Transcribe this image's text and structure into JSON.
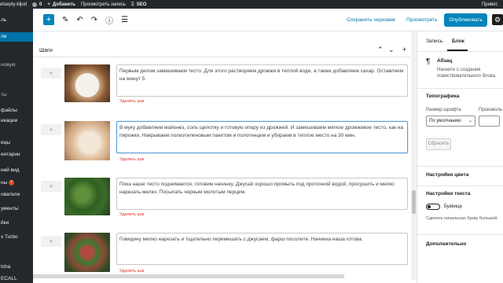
{
  "admin_bar": {
    "site": "etsepty-bljud",
    "comments": "0",
    "new": "Добавить",
    "view": "Просмотреть запись",
    "seo": "SEO",
    "greeting": "Привет, "
  },
  "side_menu": {
    "items": [
      "ль",
      "ли",
      "новую",
      "ты",
      "файлы",
      "икации",
      "ицы",
      "ентарии",
      "ний вид",
      "ны",
      "ователи",
      "ументы",
      "йки",
      "x Turbo",
      "tcha",
      "ECALL"
    ],
    "plugins_badge": "7"
  },
  "toolbar": {
    "save_draft": "Сохранить черновик",
    "preview": "Просмотреть",
    "publish": "Опубликовать"
  },
  "block": {
    "title": "Шаги",
    "steps": [
      {
        "text": "Первым делом замешиваем тесто. Для этого растворяем дрожжи в теплой воде, а также добавляем сахар. Оставляем на минут 5.",
        "delete": "Удалить шаг"
      },
      {
        "text": "В муку добавляем майонез, соль щепотку и готовую опару из дрожжей. И замешиваем мягкое дрожжевое тесто, как на пирожки. Накрываем полиэтиленовым пакетом и полотенцем и убираем в теплое место на 30 мин.",
        "delete": "Удалить шаг"
      },
      {
        "text": "Пока наше тесто поднимается, готовим начинку. Джусай хорошо промыть под проточной водой, просушить и мелко нарезать мелко. Посыпать черным молотым перцем.",
        "delete": "Удалить шаг"
      },
      {
        "text": "Говядину мелко нарезать и тщательно перемешать с джусаем, фарш посолите. Начинка наша готова.",
        "delete": "Удалить шаг"
      }
    ]
  },
  "panel": {
    "tabs": [
      "Запись",
      "Блок"
    ],
    "block_name": "Абзац",
    "block_desc": "Начните с создания повествовательного блока.",
    "typography": "Типографика",
    "font_size_label": "Размер шрифта",
    "custom_label": "Произволь",
    "font_size_value": "По умолчанию",
    "reset": "Сбросить",
    "color_settings": "Настройки цвета",
    "text_settings": "Настройки текста",
    "dropcap": "Буквица",
    "dropcap_help": "Сделать начальную букву большой.",
    "advanced": "Дополнительно"
  },
  "colors": {
    "accent": "#0085ba",
    "admin_dark": "#23282d",
    "delete": "#dc3232"
  }
}
